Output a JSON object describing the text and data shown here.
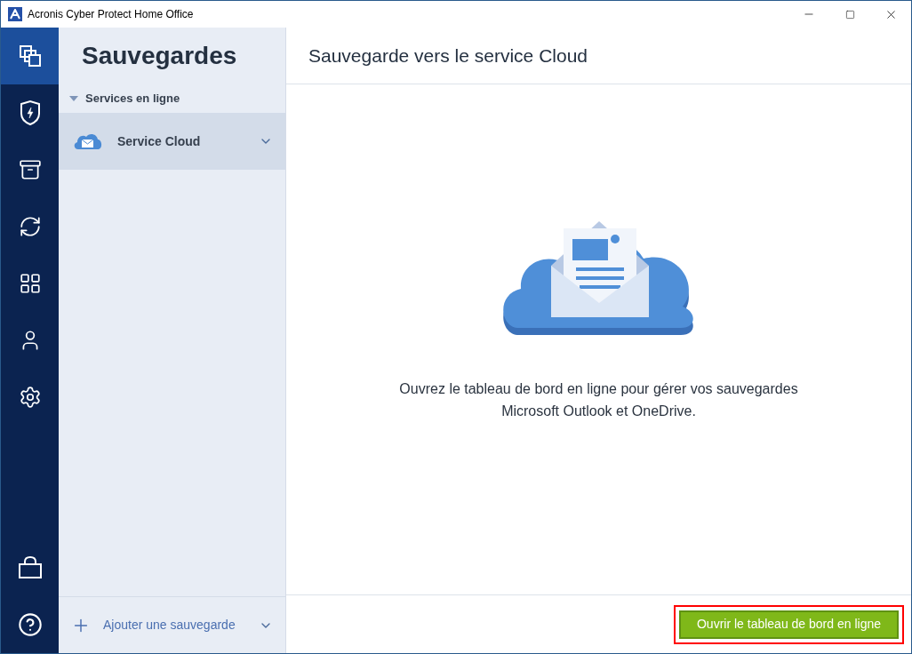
{
  "window": {
    "title": "Acronis Cyber Protect Home Office"
  },
  "nav": {
    "top": [
      {
        "kind": "backup",
        "selected": true
      },
      {
        "kind": "protection",
        "selected": false
      },
      {
        "kind": "archive",
        "selected": false
      },
      {
        "kind": "sync",
        "selected": false
      },
      {
        "kind": "tools",
        "selected": false
      },
      {
        "kind": "account",
        "selected": false
      },
      {
        "kind": "settings",
        "selected": false
      }
    ],
    "bottom": [
      {
        "kind": "store",
        "selected": false
      },
      {
        "kind": "help",
        "selected": false
      }
    ]
  },
  "sidebar": {
    "title": "Sauvegardes",
    "group": {
      "label": "Services en ligne",
      "expanded": true
    },
    "items": [
      {
        "label": "Service Cloud",
        "selected": true
      }
    ],
    "add_button": "Ajouter une sauvegarde"
  },
  "main": {
    "title": "Sauvegarde vers le service Cloud",
    "message": "Ouvrez le tableau de bord en ligne pour gérer vos sauvegardes Microsoft Outlook et OneDrive.",
    "button": "Ouvrir le tableau de bord en ligne"
  }
}
